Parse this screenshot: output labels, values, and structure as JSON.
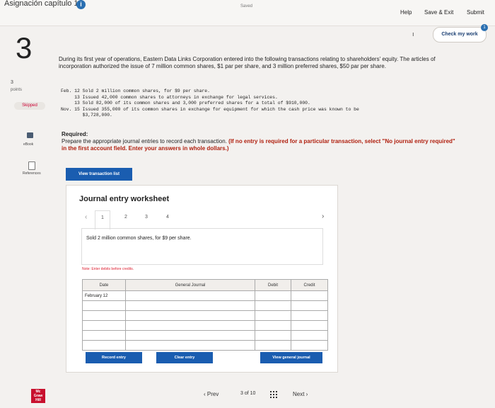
{
  "header": {
    "title": "Asignación capítulo 18",
    "saved": "Saved",
    "help": "Help",
    "save_exit": "Save & Exit",
    "submit": "Submit"
  },
  "question": {
    "number": "3",
    "points": "3",
    "points_label": "points",
    "status": "Skipped",
    "check_label": "Check my work",
    "check_count": "1",
    "intro": "During its first year of operations, Eastern Data Links Corporation entered into the following transactions relating to shareholders' equity. The articles of incorporation authorized the issue of 7 million common shares, $1 par per share, and 3 million preferred shares, $50 par per share.",
    "transactions": [
      "Feb. 12 Sold 2 million common shares, for $9 per share.",
      "     13 Issued 42,000 common shares to attorneys in exchange for legal services.",
      "     13 Sold 82,000 of its common shares and 3,000 preferred shares for a total of $910,000.",
      "Nov. 15 Issued 355,000 of its common shares in exchange for equipment for which the cash price was known to be",
      "        $3,728,000."
    ],
    "required_heading": "Required:",
    "required_text": "Prepare the appropriate journal entries to record each transaction.",
    "required_bold": "(If no entry is required for a particular transaction, select \"No journal entry required\" in the first account field. Enter your answers in whole dollars.)"
  },
  "sidebar": {
    "ebook": "eBook",
    "references": "References",
    "logo": [
      "Mc",
      "Graw",
      "Hill"
    ]
  },
  "worksheet": {
    "view_button": "View transaction list",
    "title": "Journal entry worksheet",
    "pages": [
      "1",
      "2",
      "3",
      "4"
    ],
    "description": "Sold 2 million common shares, for $9 per share.",
    "note": "Note: Enter debits before credits.",
    "columns": [
      "Date",
      "General Journal",
      "Debit",
      "Credit"
    ],
    "rows": [
      [
        "February 12",
        "",
        "",
        ""
      ],
      [
        "",
        "",
        "",
        ""
      ],
      [
        "",
        "",
        "",
        ""
      ],
      [
        "",
        "",
        "",
        ""
      ],
      [
        "",
        "",
        "",
        ""
      ],
      [
        "",
        "",
        "",
        ""
      ]
    ],
    "record_button": "Record entry",
    "clear_button": "Clear entry",
    "view_journal_button": "View general journal"
  },
  "footer": {
    "prev": "Prev",
    "page_current": "3",
    "page_of": "of",
    "page_total": "10",
    "next": "Next"
  }
}
